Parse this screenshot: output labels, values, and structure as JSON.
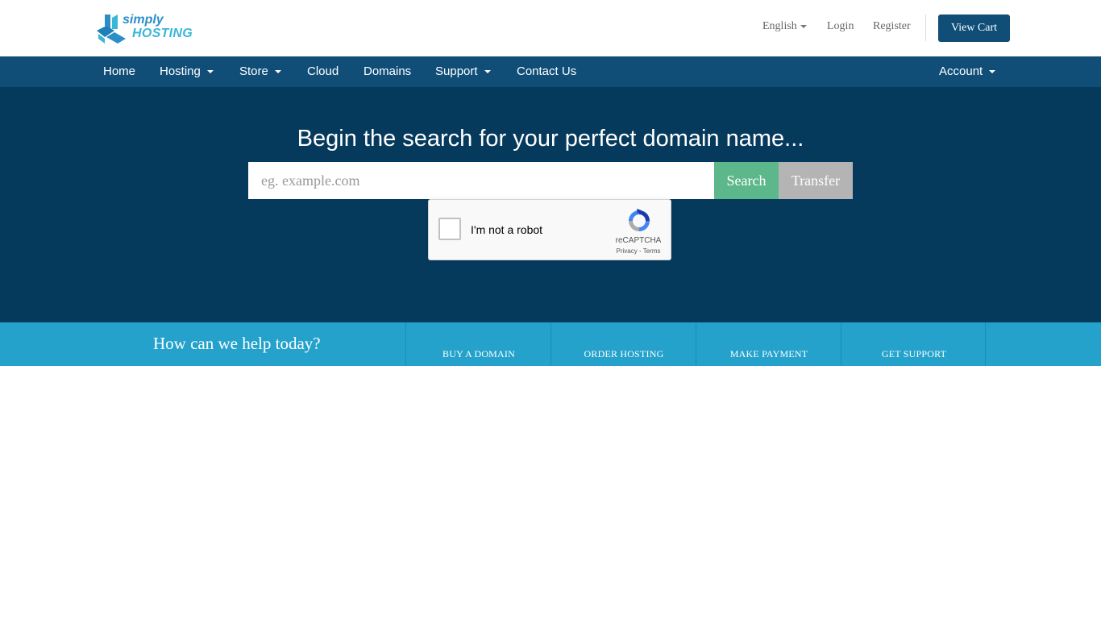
{
  "header": {
    "logo_line1": "simply",
    "logo_line2": "HOSTING",
    "language": "English",
    "login": "Login",
    "register": "Register",
    "view_cart": "View Cart"
  },
  "nav": {
    "items": [
      {
        "label": "Home",
        "dropdown": false
      },
      {
        "label": "Hosting",
        "dropdown": true
      },
      {
        "label": "Store",
        "dropdown": true
      },
      {
        "label": "Cloud",
        "dropdown": false
      },
      {
        "label": "Domains",
        "dropdown": false
      },
      {
        "label": "Support",
        "dropdown": true
      },
      {
        "label": "Contact Us",
        "dropdown": false
      }
    ],
    "account": "Account"
  },
  "hero": {
    "title": "Begin the search for your perfect domain name...",
    "search_placeholder": "eg. example.com",
    "search_button": "Search",
    "transfer_button": "Transfer"
  },
  "recaptcha": {
    "label": "I'm not a robot",
    "brand": "reCAPTCHA",
    "terms": "Privacy - Terms"
  },
  "help": {
    "title": "How can we help today?",
    "links": [
      "BUY A DOMAIN",
      "ORDER HOSTING",
      "MAKE PAYMENT",
      "GET SUPPORT"
    ]
  },
  "colors": {
    "primary": "#104e78",
    "hero_bg": "#063a5c",
    "help_bg": "#24a2cb",
    "search_btn": "#5cb88a",
    "transfer_btn": "#b4b4b4"
  }
}
